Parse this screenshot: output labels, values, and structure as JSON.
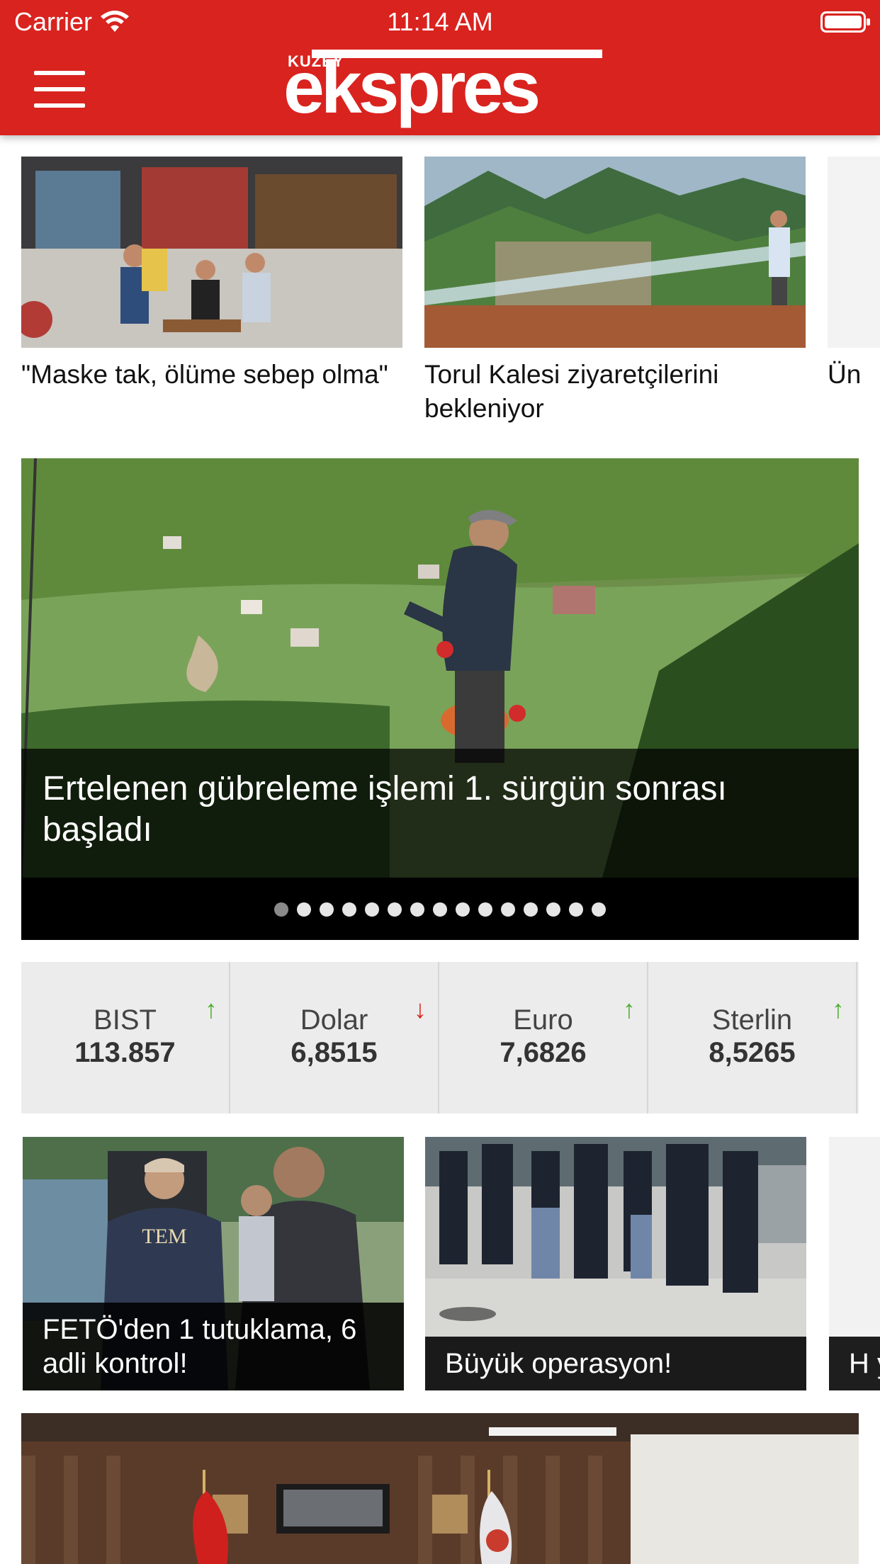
{
  "status_bar": {
    "carrier": "Carrier",
    "time": "11:14 AM"
  },
  "header": {
    "logo_small": "KUZEY",
    "logo_big": "ekspres"
  },
  "top_cards": [
    {
      "title": "\"Maske tak, ölüme sebep olma\""
    },
    {
      "title": "Torul Kalesi ziyaretçilerini bekleniyor"
    },
    {
      "title": "Ün"
    }
  ],
  "featured": {
    "title": "Ertelenen gübreleme işlemi 1. sürgün sonrası başladı",
    "dots_total": 15,
    "active_index": 0
  },
  "currency": [
    {
      "name": "BIST",
      "value": "113.857",
      "trend": "up"
    },
    {
      "name": "Dolar",
      "value": "6,8515",
      "trend": "down"
    },
    {
      "name": "Euro",
      "value": "7,6826",
      "trend": "up"
    },
    {
      "name": "Sterlin",
      "value": "8,5265",
      "trend": "up"
    }
  ],
  "lower_cards": [
    {
      "title": "FETÖ'den 1 tutuklama, 6 adli kontrol!",
      "badge": "TEM"
    },
    {
      "title": "Büyük operasyon!"
    },
    {
      "title": "H y"
    }
  ],
  "colors": {
    "brand": "#d9231f",
    "up": "#4caf2d",
    "down": "#d9231f"
  }
}
